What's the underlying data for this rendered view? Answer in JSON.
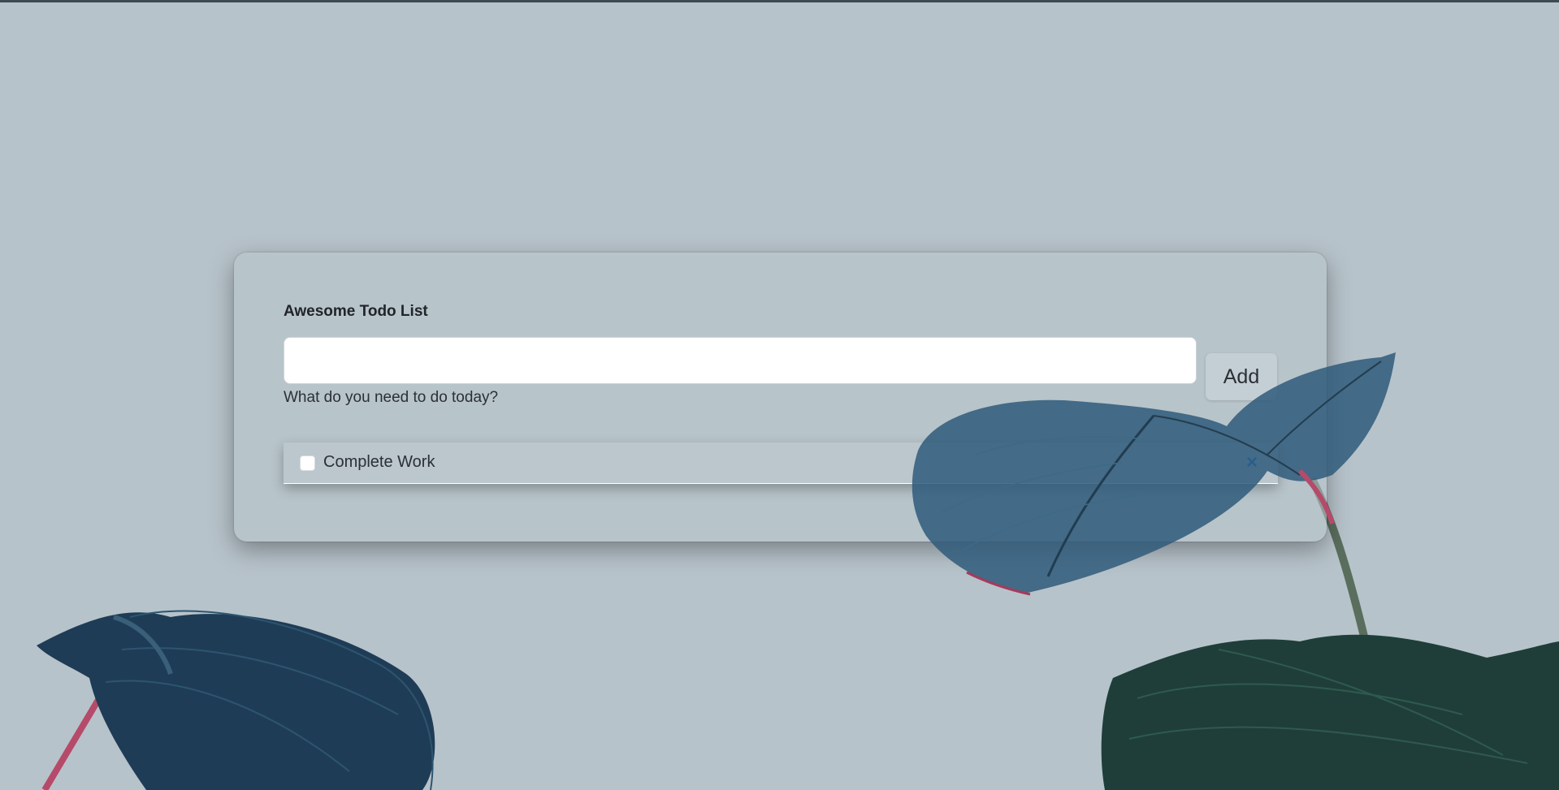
{
  "app": {
    "title": "Awesome Todo List"
  },
  "form": {
    "input_value": "",
    "input_placeholder": "",
    "helper_text": "What do you need to do today?",
    "add_label": "Add"
  },
  "todos": [
    {
      "text": "Complete Work",
      "done": false,
      "delete_icon": "×"
    }
  ],
  "colors": {
    "background": "#b7c3ca",
    "accent": "#1a6cf0",
    "leaf_dark": "#1f3a4c"
  },
  "icons": {
    "delete": "close-icon",
    "checkbox": "checkbox-icon"
  }
}
